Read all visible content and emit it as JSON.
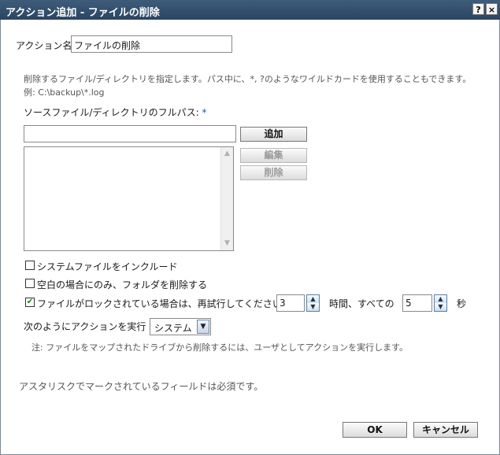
{
  "window": {
    "title": "アクション追加 - ファイルの削除",
    "help_icon": "?",
    "close_icon": "×"
  },
  "action_name": {
    "label": "アクション名",
    "value": "ファイルの削除"
  },
  "description": {
    "line1": "削除するファイル/ディレクトリを指定します。パス中に、*, ?のようなワイルドカードを使用することもできます。",
    "line2": "例: C:\\backup\\*.log"
  },
  "source": {
    "label": "ソースファイル/ディレクトリのフルパス:",
    "required": "*",
    "input_value": "",
    "list_items": []
  },
  "buttons": {
    "add": "追加",
    "edit": "編集",
    "delete": "削除",
    "ok": "OK",
    "cancel": "キャンセル"
  },
  "options": {
    "include_system": {
      "label": "システムファイルをインクルード",
      "checked": false
    },
    "delete_empty_only": {
      "label": "空白の場合にのみ、フォルダを削除する",
      "checked": false
    },
    "retry_locked": {
      "label": "ファイルがロックされている場合は、再試行してください",
      "checked": true,
      "retry_count": "3",
      "middle_text": "時間、すべての",
      "interval": "5",
      "unit": "秒"
    }
  },
  "run_as": {
    "label": "次のようにアクションを実行",
    "required": "*",
    "selected": "システム"
  },
  "note": "注: ファイルをマップされたドライブから削除するには、ユーザとしてアクションを実行します。",
  "footer_note": "アスタリスクでマークされているフィールドは必須です。"
}
